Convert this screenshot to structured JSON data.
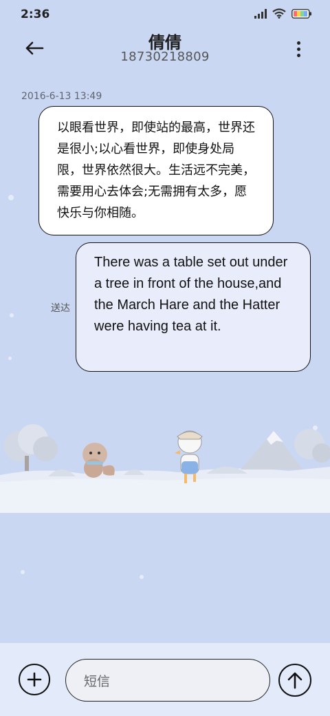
{
  "status_bar": {
    "time": "2:36",
    "icons": [
      "signal-icon",
      "wifi-icon",
      "battery-icon"
    ],
    "battery_colors": [
      "#ff6a6a",
      "#ffd24a",
      "#7fd7a0",
      "#7aa9ff"
    ]
  },
  "header": {
    "contact_name": "倩倩",
    "contact_number": "18730218809",
    "back_icon": "back-arrow-icon",
    "more_icon": "more-vertical-icon"
  },
  "conversation": {
    "timestamp": "2016-6-13 13:49",
    "messages": [
      {
        "direction": "incoming",
        "text": "以眼看世界，即使站的最高，世界还是很小;以心看世界，即使身处局限，世界依然很大。生活远不完美，需要用心去体会;无需拥有太多，愿快乐与你相随。"
      },
      {
        "direction": "outgoing",
        "text": "There was a table set out under a tree in front of the house,and the March Hare and the Hatter were having tea at it.",
        "status": "送达"
      }
    ]
  },
  "input_bar": {
    "placeholder": "短信",
    "add_icon": "add-icon",
    "send_icon": "send-arrow-icon"
  },
  "theme": {
    "background": "#c9d7f2",
    "incoming_bubble": "#ffffff",
    "outgoing_bubble": "#e8ecfb",
    "input_bar_bg": "#e3ebfb"
  }
}
